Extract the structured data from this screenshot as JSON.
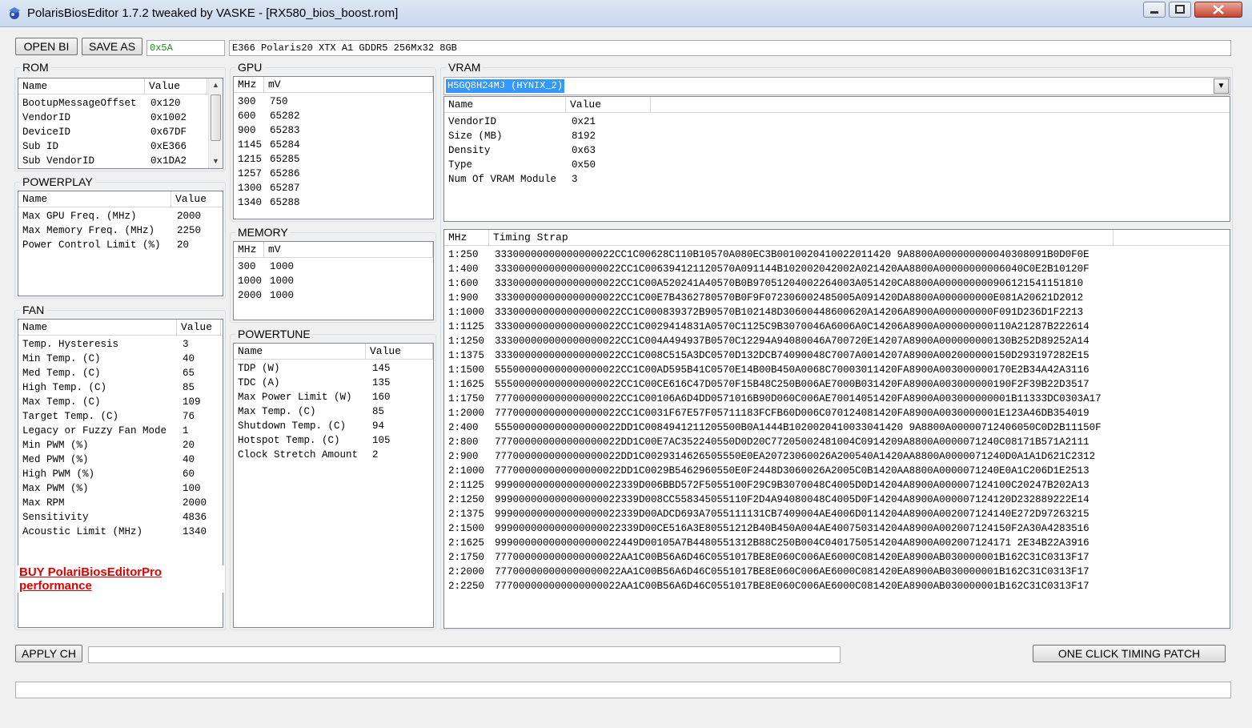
{
  "window": {
    "title": "PolarisBiosEditor 1.7.2 tweaked by VASKE - [RX580_bios_boost.rom]"
  },
  "toolbar": {
    "open_label": "OPEN BI",
    "save_label": "SAVE AS",
    "checksum_value": "0x5A",
    "rom_info": "E366 Polaris20 XTX A1 GDDR5 256Mx32 8GB"
  },
  "rom": {
    "title": "ROM",
    "headers": [
      "Name",
      "Value"
    ],
    "rows": [
      [
        "BootupMessageOffset",
        "0x120"
      ],
      [
        "VendorID",
        "0x1002"
      ],
      [
        "DeviceID",
        "0x67DF"
      ],
      [
        "Sub ID",
        "0xE366"
      ],
      [
        "Sub VendorID",
        "0x1DA2"
      ]
    ]
  },
  "powerplay": {
    "title": "POWERPLAY",
    "headers": [
      "Name",
      "Value"
    ],
    "rows": [
      [
        "Max GPU Freq. (MHz)",
        "2000"
      ],
      [
        "Max Memory Freq. (MHz)",
        "2250"
      ],
      [
        "Power Control Limit (%)",
        "20"
      ]
    ]
  },
  "fan": {
    "title": "FAN",
    "headers": [
      "Name",
      "Value"
    ],
    "rows": [
      [
        "Temp. Hysteresis",
        "3"
      ],
      [
        "Min Temp. (C)",
        "40"
      ],
      [
        "Med Temp. (C)",
        "65"
      ],
      [
        "High Temp. (C)",
        "85"
      ],
      [
        "Max Temp. (C)",
        "109"
      ],
      [
        "Target Temp. (C)",
        "76"
      ],
      [
        "Legacy or Fuzzy Fan Mode",
        "1"
      ],
      [
        "Min PWM (%)",
        "20"
      ],
      [
        "Med PWM (%)",
        "40"
      ],
      [
        "High PWM (%)",
        "60"
      ],
      [
        "Max PWM (%)",
        "100"
      ],
      [
        "Max RPM",
        "2000"
      ],
      [
        "Sensitivity",
        "4836"
      ],
      [
        "Acoustic Limit (MHz)",
        "1340"
      ]
    ],
    "buy_link": "BUY PolariBiosEditorPro performance"
  },
  "gpu": {
    "title": "GPU",
    "headers": [
      "MHz",
      "mV"
    ],
    "rows": [
      [
        "300",
        "750"
      ],
      [
        "600",
        "65282"
      ],
      [
        "900",
        "65283"
      ],
      [
        "1145",
        "65284"
      ],
      [
        "1215",
        "65285"
      ],
      [
        "1257",
        "65286"
      ],
      [
        "1300",
        "65287"
      ],
      [
        "1340",
        "65288"
      ]
    ]
  },
  "memory": {
    "title": "MEMORY",
    "headers": [
      "MHz",
      "mV"
    ],
    "rows": [
      [
        "300",
        "1000"
      ],
      [
        "1000",
        "1000"
      ],
      [
        "2000",
        "1000"
      ]
    ]
  },
  "powertune": {
    "title": "POWERTUNE",
    "headers": [
      "Name",
      "Value"
    ],
    "rows": [
      [
        "TDP (W)",
        "145"
      ],
      [
        "TDC (A)",
        "135"
      ],
      [
        "Max Power Limit (W)",
        "160"
      ],
      [
        "Max Temp. (C)",
        "85"
      ],
      [
        "Shutdown Temp. (C)",
        "94"
      ],
      [
        "Hotspot Temp. (C)",
        "105"
      ],
      [
        "Clock Stretch Amount",
        "2"
      ]
    ]
  },
  "vram": {
    "title": "VRAM",
    "selected_module": "H5GQ8H24MJ (HYNIX_2)",
    "headers": [
      "Name",
      "Value"
    ],
    "rows": [
      [
        "VendorID",
        "0x21"
      ],
      [
        "Size (MB)",
        "8192"
      ],
      [
        "Density",
        "0x63"
      ],
      [
        "Type",
        "0x50"
      ],
      [
        "Num Of VRAM Module",
        "3"
      ]
    ]
  },
  "timings": {
    "headers": [
      "MHz",
      "Timing Strap"
    ],
    "rows": [
      [
        "1:250",
        "33300000000000000022CC1C00628C110B10570A080EC3B0010020410022011420 9A8800A000000000040308091B0D0F0E"
      ],
      [
        "1:400",
        "333000000000000000022CC1C006394121120570A091144B102002042002A021420AA8800A00000000006040C0E2B10120F"
      ],
      [
        "1:600",
        "333000000000000000022CC1C00A520241A40570B0B97051204002264003A051420CA8800A000000000906121541151810"
      ],
      [
        "1:900",
        "333000000000000000022CC1C00E7B4362780570B0F9F072306002485005A091420DA8800A000000000E081A20621D2012"
      ],
      [
        "1:1000",
        "333000000000000000022CC1C000839372B90570B102148D30600448600620A14206A8900A000000000F091D236D1F2213"
      ],
      [
        "1:1125",
        "333000000000000000022CC1C0029414831A0570C1125C9B3070046A6006A0C14206A8900A000000000110A21287B222614"
      ],
      [
        "1:1250",
        "333000000000000000022CC1C004A494937B0570C12294A94080046A700720E14207A8900A000000000130B252D89252A14"
      ],
      [
        "1:1375",
        "333000000000000000022CC1C008C515A3DC0570D132DCB74090048C7007A0014207A8900A002000000150D293197282E15"
      ],
      [
        "1:1500",
        "555000000000000000022CC1C00AD595B41C0570E14B00B450A0068C70003011420FA8900A003000000170E2B34A42A3116"
      ],
      [
        "1:1625",
        "555000000000000000022CC1C00CE616C47D0570F15B48C250B006AE7000B031420FA8900A003000000190F2F39B22D3517"
      ],
      [
        "1:1750",
        "777000000000000000022CC1C00106A6D4DD0571016B90D060C006AE70014051420FA8900A003000000001B11333DC0303A17"
      ],
      [
        "1:2000",
        "777000000000000000022CC1C0031F67E57F05711183FCFB60D006C070124081420FA8900A0030000001E123A46DB354019"
      ],
      [
        "2:400",
        "555000000000000000022DD1C0084941211205500B0A1444B1020020410033041420 9A8800A00000712406050C0D2B11150F"
      ],
      [
        "2:800",
        "777000000000000000022DD1C00E7AC352240550D0D20C77205002481004C0914209A8800A0000071240C08171B571A2111"
      ],
      [
        "2:900",
        "777000000000000000022DD1C0029314626505550E0EA20723060026A200540A1420AA8800A0000071240D0A1A1D621C2312"
      ],
      [
        "2:1000",
        "777000000000000000022DD1C0029B5462960550E0F2448D3060026A2005C0B1420AA8800A0000071240E0A1C206D1E2513"
      ],
      [
        "2:1125",
        "999000000000000000022339D006BBD572F5055100F29C9B3070048C4005D0D14204A8900A000007124100C20247B202A13"
      ],
      [
        "2:1250",
        "999000000000000000022339D008CC558345055110F2D4A94080048C4005D0F14204A8900A000007124120D232889222E14"
      ],
      [
        "2:1375",
        "999000000000000000022339D00ADCD693A7055111131CB7409004AE4006D0114204A8900A002007124140E272D97263215"
      ],
      [
        "2:1500",
        "999000000000000000022339D00CE516A3E80551212B40B450A004AE400750314204A8900A002007124150F2A30A4283516"
      ],
      [
        "2:1625",
        "999000000000000000022449D00105A7B4480551312B88C250B004C0401750514204A8900A002007124171 2E34B22A3916"
      ],
      [
        "2:1750",
        "777000000000000000022AA1C00B56A6D46C0551017BE8E060C006AE6000C081420EA8900AB030000001B162C31C0313F17"
      ],
      [
        "2:2000",
        "777000000000000000022AA1C00B56A6D46C0551017BE8E060C006AE6000C081420EA8900AB030000001B162C31C0313F17"
      ],
      [
        "2:2250",
        "777000000000000000022AA1C00B56A6D46C0551017BE8E060C006AE6000C081420EA8900AB030000001B162C31C0313F17"
      ]
    ]
  },
  "bottom": {
    "apply_label": "APPLY CH",
    "apply_value": "",
    "patch_label": "ONE CLICK TIMING PATCH",
    "status_value": ""
  }
}
